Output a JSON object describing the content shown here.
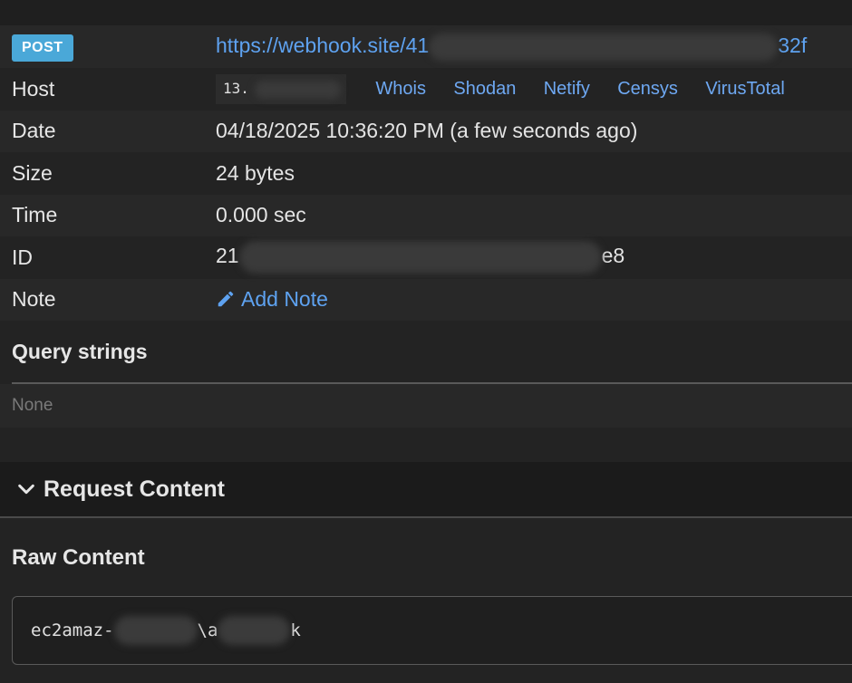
{
  "request": {
    "method": "POST",
    "url_start": "https://webhook.site/41",
    "url_end": "32f",
    "labels": {
      "host": "Host",
      "date": "Date",
      "size": "Size",
      "time": "Time",
      "id": "ID",
      "note": "Note"
    },
    "host_prefix": "13.",
    "host_links": [
      "Whois",
      "Shodan",
      "Netify",
      "Censys",
      "VirusTotal"
    ],
    "date": "04/18/2025 10:36:20 PM (a few seconds ago)",
    "size": "24 bytes",
    "time": "0.000 sec",
    "id_start": "21",
    "id_end": "e8",
    "add_note_label": "Add Note"
  },
  "query_strings": {
    "heading": "Query strings",
    "empty_text": "None"
  },
  "request_content": {
    "title": "Request Content",
    "raw_heading": "Raw Content",
    "raw_part1": "ec2amaz-",
    "raw_part2": "\\a",
    "raw_part3": "k"
  },
  "colors": {
    "badge": "#4aa8d8",
    "link": "#5ea2f0",
    "background": "#232323"
  },
  "icons": {
    "note": "pencil-icon",
    "section_toggle": "chevron-down-icon"
  }
}
